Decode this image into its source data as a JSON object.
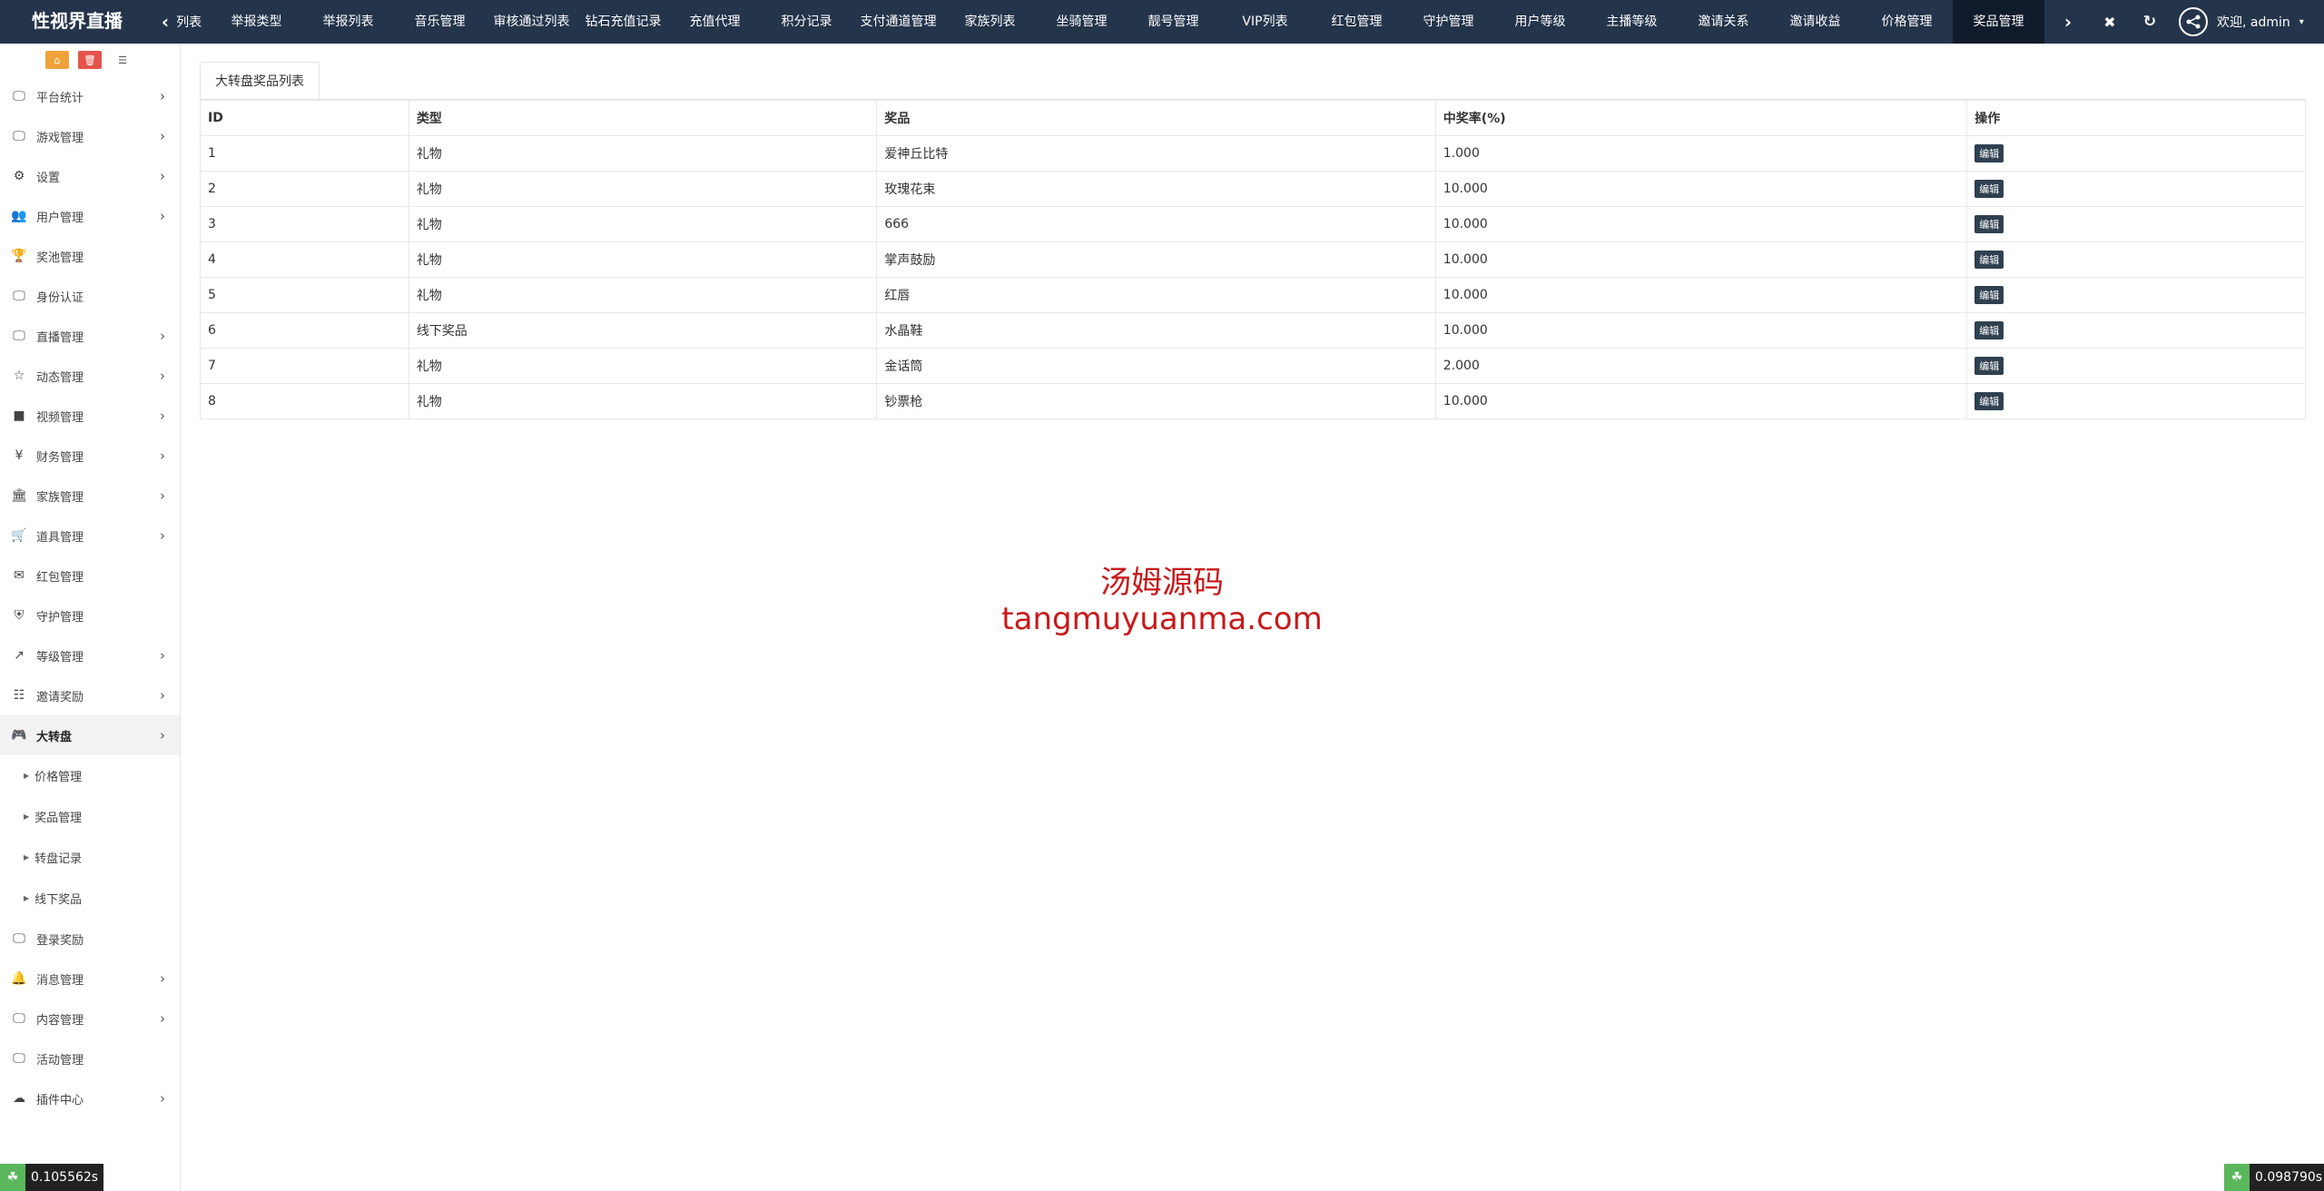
{
  "app": {
    "brand": "性视界直播"
  },
  "nav": {
    "prev_label": "列表",
    "tabs": [
      "举报类型",
      "举报列表",
      "音乐管理",
      "审核通过列表",
      "钻石充值记录",
      "充值代理",
      "积分记录",
      "支付通道管理",
      "家族列表",
      "坐骑管理",
      "靓号管理",
      "VIP列表",
      "红包管理",
      "守护管理",
      "用户等级",
      "主播等级",
      "邀请关系",
      "邀请收益",
      "价格管理",
      "奖品管理"
    ],
    "active_tab": "奖品管理",
    "user_label": "欢迎, admin"
  },
  "sidebar": {
    "items": [
      {
        "label": "平台统计",
        "icon": "monitor-icon",
        "arrow": true
      },
      {
        "label": "游戏管理",
        "icon": "monitor-icon",
        "arrow": true
      },
      {
        "label": "设置",
        "icon": "gears-icon",
        "arrow": true
      },
      {
        "label": "用户管理",
        "icon": "users-icon",
        "arrow": true
      },
      {
        "label": "奖池管理",
        "icon": "trophy-icon",
        "arrow": false
      },
      {
        "label": "身份认证",
        "icon": "monitor-icon",
        "arrow": false
      },
      {
        "label": "直播管理",
        "icon": "monitor-icon",
        "arrow": true
      },
      {
        "label": "动态管理",
        "icon": "star-icon",
        "arrow": true
      },
      {
        "label": "视频管理",
        "icon": "video-icon",
        "arrow": true
      },
      {
        "label": "财务管理",
        "icon": "yen-icon",
        "arrow": true
      },
      {
        "label": "家族管理",
        "icon": "bank-icon",
        "arrow": true
      },
      {
        "label": "道具管理",
        "icon": "cart-icon",
        "arrow": true
      },
      {
        "label": "红包管理",
        "icon": "envelope-icon",
        "arrow": false
      },
      {
        "label": "守护管理",
        "icon": "shield-icon",
        "arrow": false
      },
      {
        "label": "等级管理",
        "icon": "level-up-icon",
        "arrow": true
      },
      {
        "label": "邀请奖励",
        "icon": "sitemap-icon",
        "arrow": true
      },
      {
        "label": "大转盘",
        "icon": "gamepad-icon",
        "arrow": true
      }
    ],
    "sub_items": [
      "价格管理",
      "奖品管理",
      "转盘记录",
      "线下奖品"
    ],
    "items_after": [
      {
        "label": "登录奖励",
        "icon": "monitor-icon",
        "arrow": false
      },
      {
        "label": "消息管理",
        "icon": "bell-icon",
        "arrow": true
      },
      {
        "label": "内容管理",
        "icon": "monitor-icon",
        "arrow": true
      },
      {
        "label": "活动管理",
        "icon": "monitor-icon",
        "arrow": false
      },
      {
        "label": "插件中心",
        "icon": "cloud-icon",
        "arrow": true
      }
    ]
  },
  "main": {
    "panel_title": "大转盘奖品列表",
    "columns": [
      "ID",
      "类型",
      "奖品",
      "中奖率(%)",
      "操作"
    ],
    "rows": [
      [
        "1",
        "礼物",
        "爱神丘比特",
        "1.000"
      ],
      [
        "2",
        "礼物",
        "玫瑰花束",
        "10.000"
      ],
      [
        "3",
        "礼物",
        "666",
        "10.000"
      ],
      [
        "4",
        "礼物",
        "掌声鼓励",
        "10.000"
      ],
      [
        "5",
        "礼物",
        "红唇",
        "10.000"
      ],
      [
        "6",
        "线下奖品",
        "水晶鞋",
        "10.000"
      ],
      [
        "7",
        "礼物",
        "金话筒",
        "2.000"
      ],
      [
        "8",
        "礼物",
        "钞票枪",
        "10.000"
      ]
    ],
    "edit_label": "编辑"
  },
  "watermark": {
    "line1": "汤姆源码",
    "line2": "tangmuyuanma.com"
  },
  "timers": {
    "left": "0.105562s",
    "right": "0.098790s"
  }
}
